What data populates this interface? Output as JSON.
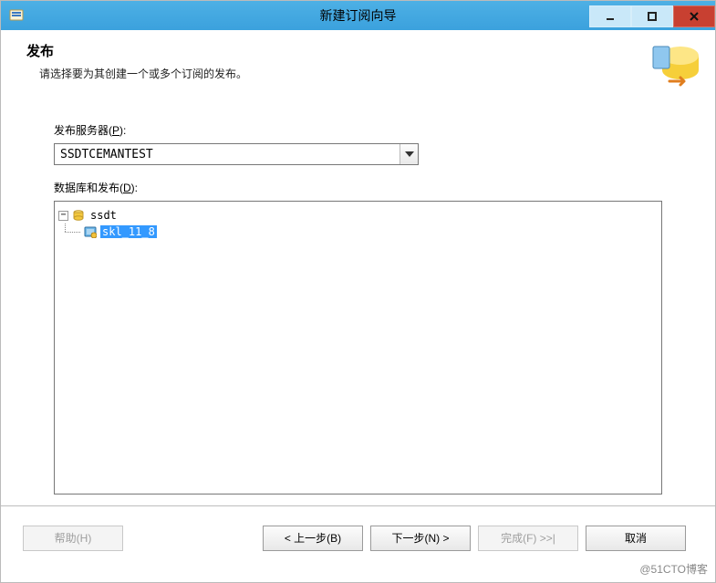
{
  "window": {
    "title": "新建订阅向导"
  },
  "header": {
    "title": "发布",
    "subtitle": "请选择要为其创建一个或多个订阅的发布。"
  },
  "form": {
    "serverLabelPrefix": "发布服务器(",
    "serverLabelKey": "P",
    "serverLabelSuffix": "):",
    "serverValue": "SSDTCEMANTEST",
    "dbLabelPrefix": "数据库和发布(",
    "dbLabelKey": "D",
    "dbLabelSuffix": "):"
  },
  "tree": {
    "root": {
      "expanded": true,
      "name": "ssdt"
    },
    "child": {
      "name": "skl_11_8",
      "selected": true
    }
  },
  "footer": {
    "help": "帮助(H)",
    "back": "< 上一步(B)",
    "next": "下一步(N) >",
    "finish": "完成(F) >>|",
    "cancel": "取消"
  },
  "watermark": "@51CTO博客"
}
